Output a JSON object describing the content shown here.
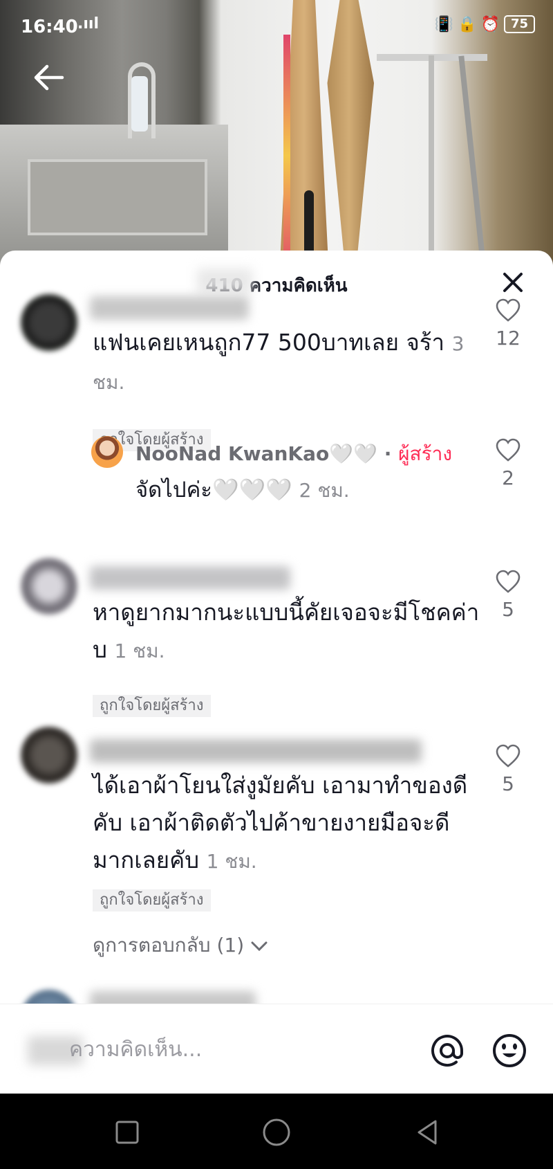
{
  "status_bar": {
    "time": "16:40",
    "signal": ".ııl",
    "battery": "75"
  },
  "sheet": {
    "title": "410 ความคิดเห็น"
  },
  "comments": [
    {
      "text": "แฟนเคยเหนถูก77 500บาทเลย จร้า",
      "time": "3 ชม.",
      "badge": "ถูกใจโดยผู้สร้าง",
      "likes": "12"
    },
    {
      "text": "หาดูยากมากนะแบบนี้คัยเจอจะมีโชคค่าบ",
      "time": "1 ชม.",
      "badge": "ถูกใจโดยผู้สร้าง",
      "likes": "5"
    },
    {
      "text": "ได้เอาผ้าโยนใส่งูมัยคับ เอามาทำของดีคับ เอาผ้าติดตัวไปค้าขายงายมือจะดีมากเลยคับ",
      "time": "1 ชม.",
      "badge": "ถูกใจโดยผู้สร้าง",
      "likes": "5",
      "view_replies": "ดูการตอบกลับ (1)"
    }
  ],
  "reply": {
    "author": "NooNad KwanKao🤍🤍",
    "separator": "·",
    "creator_label": "ผู้สร้าง",
    "text": "จัดไปค่ะ🤍🤍🤍",
    "time": "2 ชม.",
    "likes": "2"
  },
  "input": {
    "placeholder": "ความคิดเห็น..."
  },
  "colors": {
    "accent": "#fe2c55",
    "text": "#161823",
    "muted": "#6b6c72"
  },
  "icons": [
    "back-arrow-icon",
    "close-icon",
    "heart-icon",
    "at-icon",
    "emoji-icon",
    "nav-square-icon",
    "nav-circle-icon",
    "nav-triangle-icon"
  ]
}
